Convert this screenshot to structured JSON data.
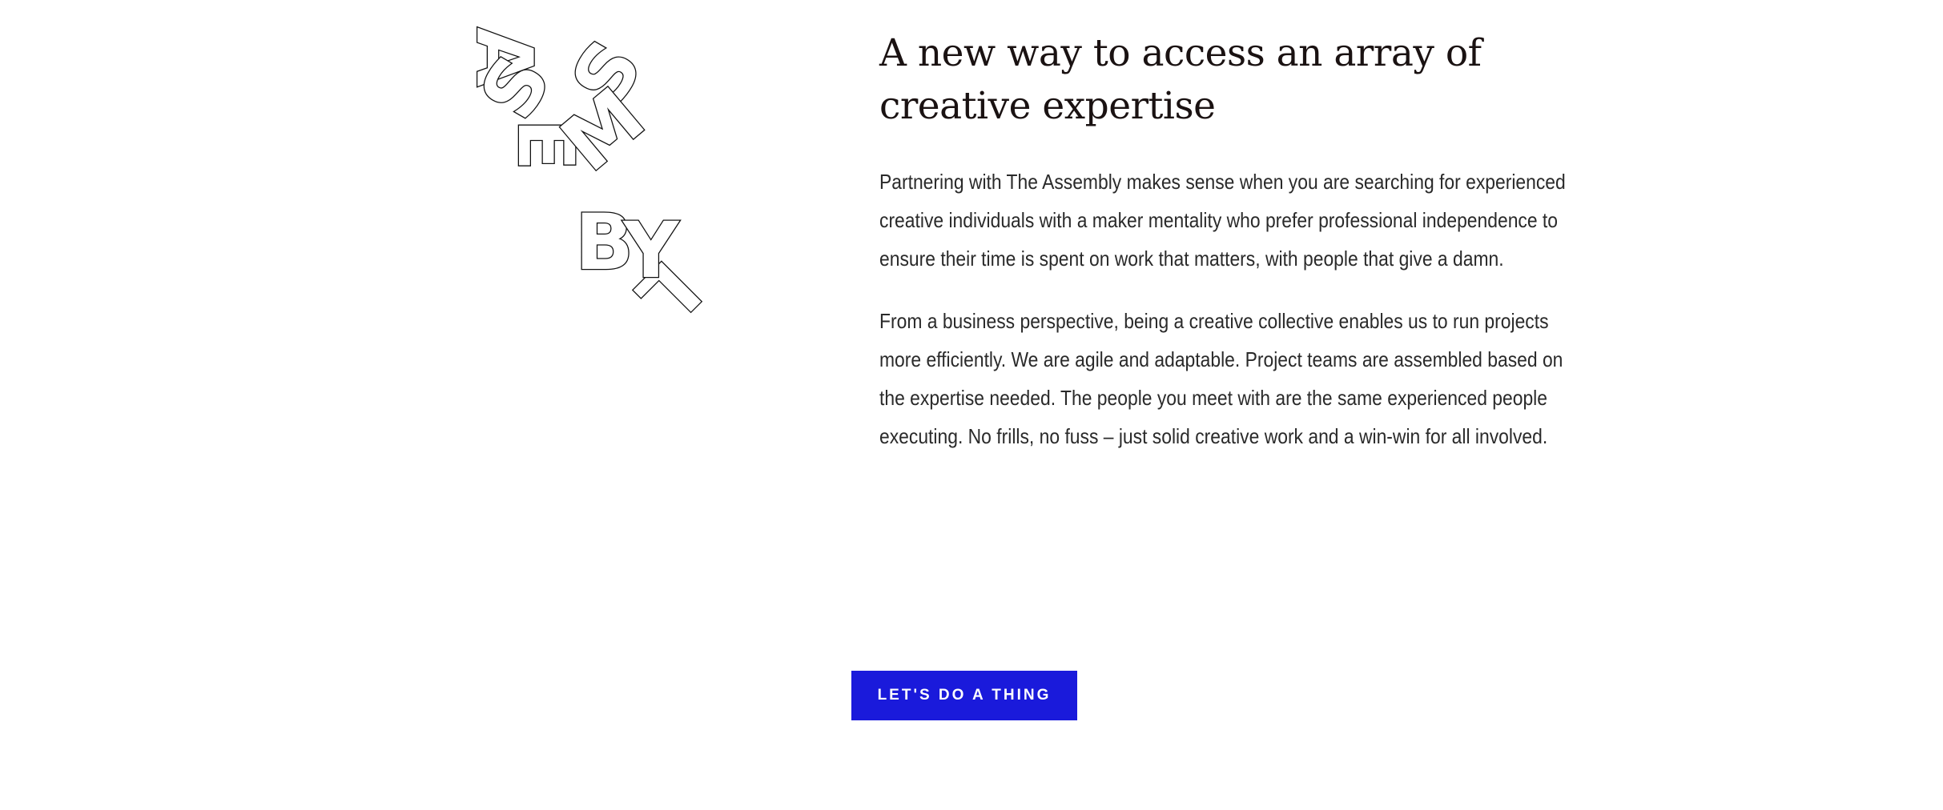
{
  "logo": {
    "letters": [
      "A",
      "S",
      "S",
      "E",
      "M",
      "B",
      "L",
      "Y"
    ]
  },
  "headline": "A new way to access an array of creative expertise",
  "paragraphs": [
    "Partnering with The Assembly makes sense when you are searching for experienced creative individuals with a maker mentality who prefer professional independence to ensure their time is spent on work that matters, with people that give a damn.",
    "From a business perspective, being a creative collective enables us to run projects more efficiently. We are agile and adaptable. Project teams are assembled based on the expertise needed. The people you meet with are the same experienced people executing. No frills, no fuss – just solid creative work and a win-win for all involved."
  ],
  "cta": {
    "label": "LET'S DO A THING"
  },
  "colors": {
    "accent": "#1a1adb",
    "text": "#2a2a2a",
    "heading": "#1a1212",
    "background": "#ffffff"
  }
}
